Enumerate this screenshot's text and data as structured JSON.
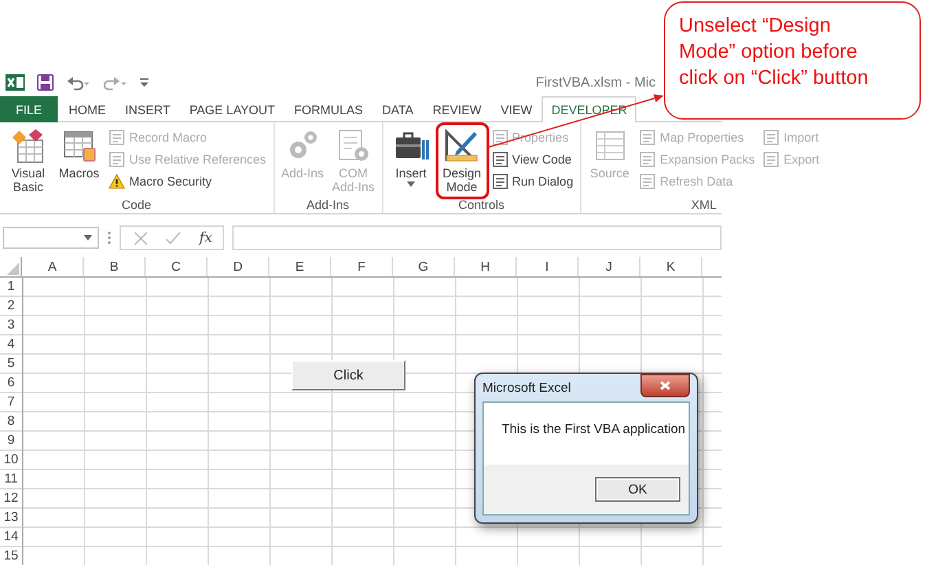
{
  "window": {
    "title": "FirstVBA.xlsm - Mic"
  },
  "tabs": [
    {
      "label": "FILE",
      "kind": "file",
      "selected": false
    },
    {
      "label": "HOME",
      "kind": "tab",
      "selected": false
    },
    {
      "label": "INSERT",
      "kind": "tab",
      "selected": false
    },
    {
      "label": "PAGE LAYOUT",
      "kind": "tab",
      "selected": false
    },
    {
      "label": "FORMULAS",
      "kind": "tab",
      "selected": false
    },
    {
      "label": "DATA",
      "kind": "tab",
      "selected": false
    },
    {
      "label": "REVIEW",
      "kind": "tab",
      "selected": false
    },
    {
      "label": "VIEW",
      "kind": "tab",
      "selected": false
    },
    {
      "label": "DEVELOPER",
      "kind": "tab",
      "selected": true
    }
  ],
  "ribbon": {
    "groups": [
      {
        "label": "Code",
        "columns": [
          {
            "kind": "large",
            "label": "Visual Basic",
            "disabled": false,
            "highlighted": false
          },
          {
            "kind": "large",
            "label": "Macros",
            "disabled": false,
            "highlighted": false
          },
          {
            "kind": "stack",
            "items": [
              {
                "label": "Record Macro",
                "disabled": true
              },
              {
                "label": "Use Relative References",
                "disabled": true
              },
              {
                "label": "Macro Security",
                "disabled": false
              }
            ]
          }
        ]
      },
      {
        "label": "Add-Ins",
        "columns": [
          {
            "kind": "large",
            "label": "Add-Ins",
            "disabled": true,
            "highlighted": false
          },
          {
            "kind": "large",
            "label": "COM Add-Ins",
            "disabled": true,
            "highlighted": false
          }
        ]
      },
      {
        "label": "Controls",
        "columns": [
          {
            "kind": "split",
            "label": "Insert",
            "disabled": false,
            "highlighted": false
          },
          {
            "kind": "large",
            "label": "Design Mode",
            "disabled": false,
            "highlighted": true
          },
          {
            "kind": "stack",
            "items": [
              {
                "label": "Properties",
                "disabled": true
              },
              {
                "label": "View Code",
                "disabled": false
              },
              {
                "label": "Run Dialog",
                "disabled": false
              }
            ]
          }
        ]
      },
      {
        "label": "XML",
        "columns": [
          {
            "kind": "large",
            "label": "Source",
            "disabled": true,
            "highlighted": false
          },
          {
            "kind": "stack",
            "items": [
              {
                "label": "Map Properties",
                "disabled": true
              },
              {
                "label": "Expansion Packs",
                "disabled": true
              },
              {
                "label": "Refresh Data",
                "disabled": true
              }
            ]
          },
          {
            "kind": "stack",
            "items": [
              {
                "label": "Import",
                "disabled": true
              },
              {
                "label": "Export",
                "disabled": true
              }
            ]
          }
        ]
      }
    ]
  },
  "formula_bar": {
    "function_label": "fx"
  },
  "sheet": {
    "columns": [
      "A",
      "B",
      "C",
      "D",
      "E",
      "F",
      "G",
      "H",
      "I",
      "J",
      "K"
    ],
    "rows": [
      "1",
      "2",
      "3",
      "4",
      "5",
      "6",
      "7",
      "8",
      "9",
      "10",
      "11",
      "12",
      "13",
      "14",
      "15"
    ],
    "button": {
      "label": "Click"
    }
  },
  "dialog": {
    "title": "Microsoft Excel",
    "message": "This is the First VBA application",
    "button": "OK"
  },
  "callout": {
    "text": "Unselect “Design Mode” option before click on “Click” button"
  }
}
